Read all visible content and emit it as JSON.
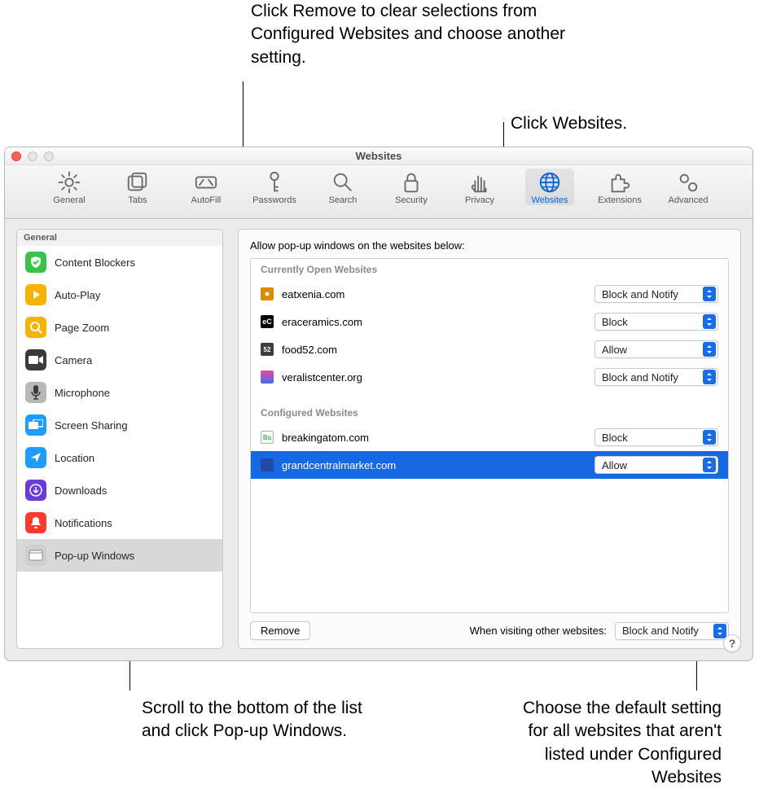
{
  "window": {
    "title": "Websites"
  },
  "callouts": {
    "top": "Click Remove to clear selections from Configured Websites and choose another setting.",
    "right": "Click Websites.",
    "bottom_left": "Scroll to the bottom of the list and click Pop-up Windows.",
    "bottom_right": "Choose the default setting for all websites that aren't listed under Configured Websites"
  },
  "toolbar": {
    "items": [
      {
        "label": "General"
      },
      {
        "label": "Tabs"
      },
      {
        "label": "AutoFill"
      },
      {
        "label": "Passwords"
      },
      {
        "label": "Search"
      },
      {
        "label": "Security"
      },
      {
        "label": "Privacy"
      },
      {
        "label": "Websites"
      },
      {
        "label": "Extensions"
      },
      {
        "label": "Advanced"
      }
    ]
  },
  "sidebar": {
    "header": "General",
    "items": [
      {
        "label": "Content Blockers",
        "icon": "content-blockers",
        "bg": "#3bc24a"
      },
      {
        "label": "Auto-Play",
        "icon": "auto-play",
        "bg": "#f6b400"
      },
      {
        "label": "Page Zoom",
        "icon": "page-zoom",
        "bg": "#f6b400"
      },
      {
        "label": "Camera",
        "icon": "camera",
        "bg": "#3a3a3c"
      },
      {
        "label": "Microphone",
        "icon": "microphone",
        "bg": "#9a9a9a"
      },
      {
        "label": "Screen Sharing",
        "icon": "screen-sharing",
        "bg": "#1f9cff"
      },
      {
        "label": "Location",
        "icon": "location",
        "bg": "#1f9cff"
      },
      {
        "label": "Downloads",
        "icon": "downloads",
        "bg": "#6a3bdb"
      },
      {
        "label": "Notifications",
        "icon": "notifications",
        "bg": "#ff3b30"
      },
      {
        "label": "Pop-up Windows",
        "icon": "popup",
        "bg": "#cfcfcf"
      }
    ]
  },
  "content": {
    "header": "Allow pop-up windows on the websites below:",
    "section1": "Currently Open Websites",
    "open_sites": [
      {
        "domain": "eatxenia.com",
        "value": "Block and Notify",
        "bg": "#d98c00"
      },
      {
        "domain": "eraceramics.com",
        "value": "Block",
        "bg": "#000"
      },
      {
        "domain": "food52.com",
        "value": "Allow",
        "bg": "#3e3e3e",
        "txt": "52"
      },
      {
        "domain": "veralistcenter.org",
        "value": "Block and Notify",
        "bg": "linear-gradient(#e74aa2,#4a6de7)"
      }
    ],
    "section2": "Configured Websites",
    "conf_sites": [
      {
        "domain": "breakingatom.com",
        "value": "Block",
        "bg": "#fff",
        "border": "#b0b0b0",
        "txt": "Ba",
        "fg": "#3dbb5a"
      },
      {
        "domain": "grandcentralmarket.com",
        "value": "Allow",
        "bg": "#2349a8"
      }
    ],
    "remove": "Remove",
    "other_label": "When visiting other websites:",
    "other_value": "Block and Notify"
  },
  "help": "?"
}
